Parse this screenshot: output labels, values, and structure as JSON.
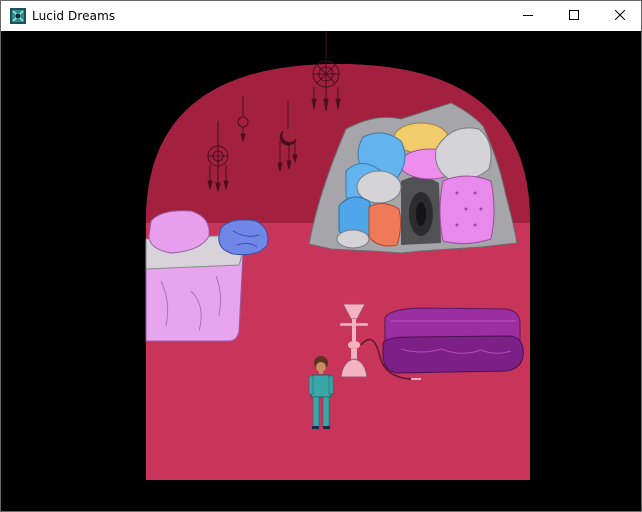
{
  "window": {
    "title": "Lucid Dreams",
    "controls": {
      "minimize_icon": "minimize-icon",
      "maximize_icon": "maximize-icon",
      "close_icon": "close-icon"
    }
  },
  "scene": {
    "room": "dream-bedroom",
    "objects": [
      "bed",
      "pillows",
      "pillow-fort",
      "dreamcatchers",
      "hookah",
      "couch",
      "player-character"
    ]
  },
  "colors": {
    "wall": "#a3213f",
    "floor": "#c9345a",
    "background": "#000000",
    "bed": "#e8a5ef",
    "player": "#3aa7a7"
  }
}
